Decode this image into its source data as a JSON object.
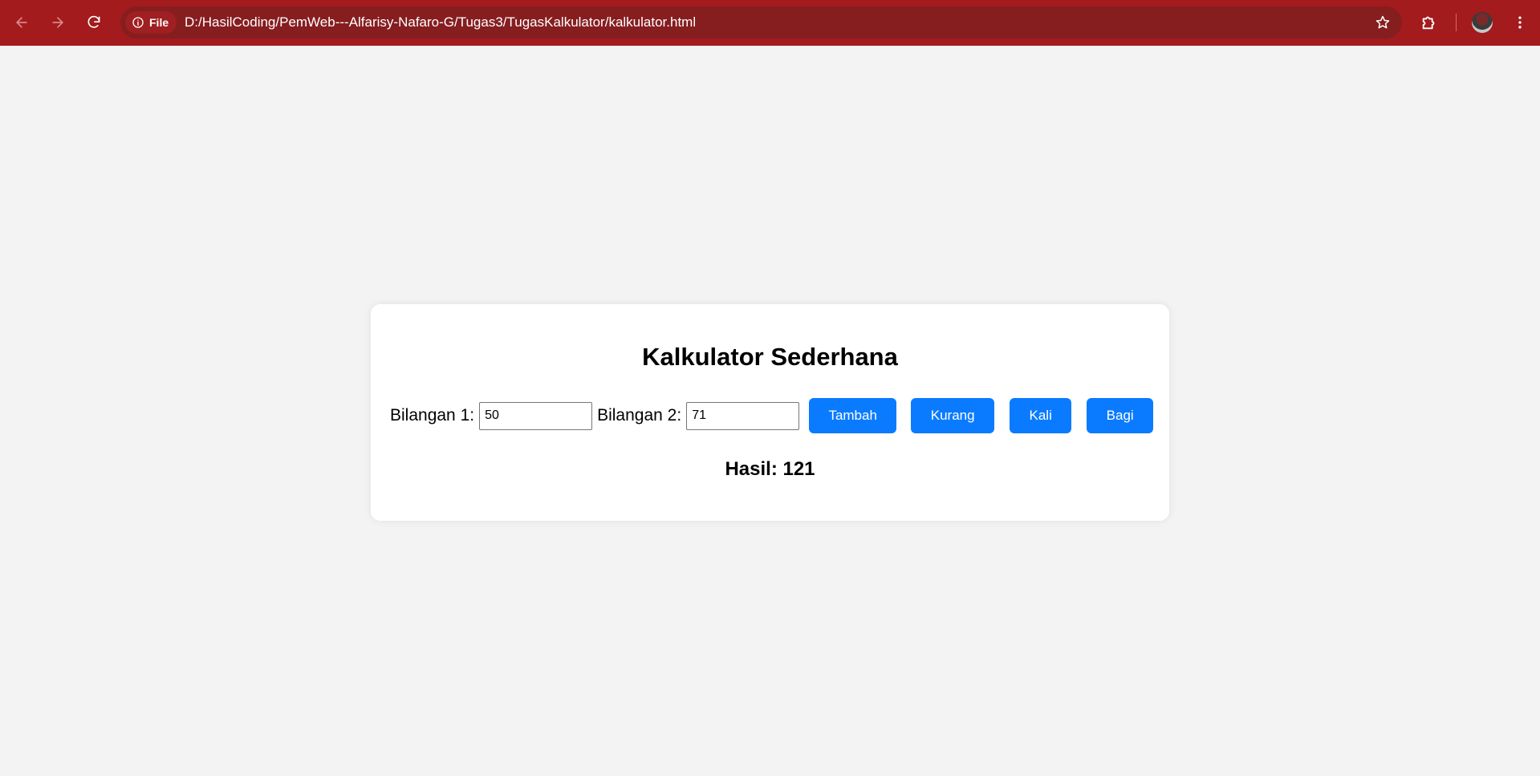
{
  "browser": {
    "site_chip_label": "File",
    "url": "D:/HasilCoding/PemWeb---Alfarisy-Nafaro-G/Tugas3/TugasKalkulator/kalkulator.html",
    "theme_color": "#a31b1d",
    "icons": {
      "back": "arrow-left-icon",
      "forward": "arrow-right-icon",
      "reload": "reload-icon",
      "info": "info-icon",
      "bookmark": "star-icon",
      "extensions": "puzzle-icon",
      "profile": "avatar",
      "menu": "kebab-menu-icon"
    }
  },
  "calculator": {
    "title": "Kalkulator Sederhana",
    "input1_label": "Bilangan 1:",
    "input1_value": "50",
    "input2_label": "Bilangan 2:",
    "input2_value": "71",
    "buttons": {
      "add": "Tambah",
      "subtract": "Kurang",
      "multiply": "Kali",
      "divide": "Bagi"
    },
    "button_color": "#0a7bff",
    "result_text": "Hasil: 121"
  }
}
